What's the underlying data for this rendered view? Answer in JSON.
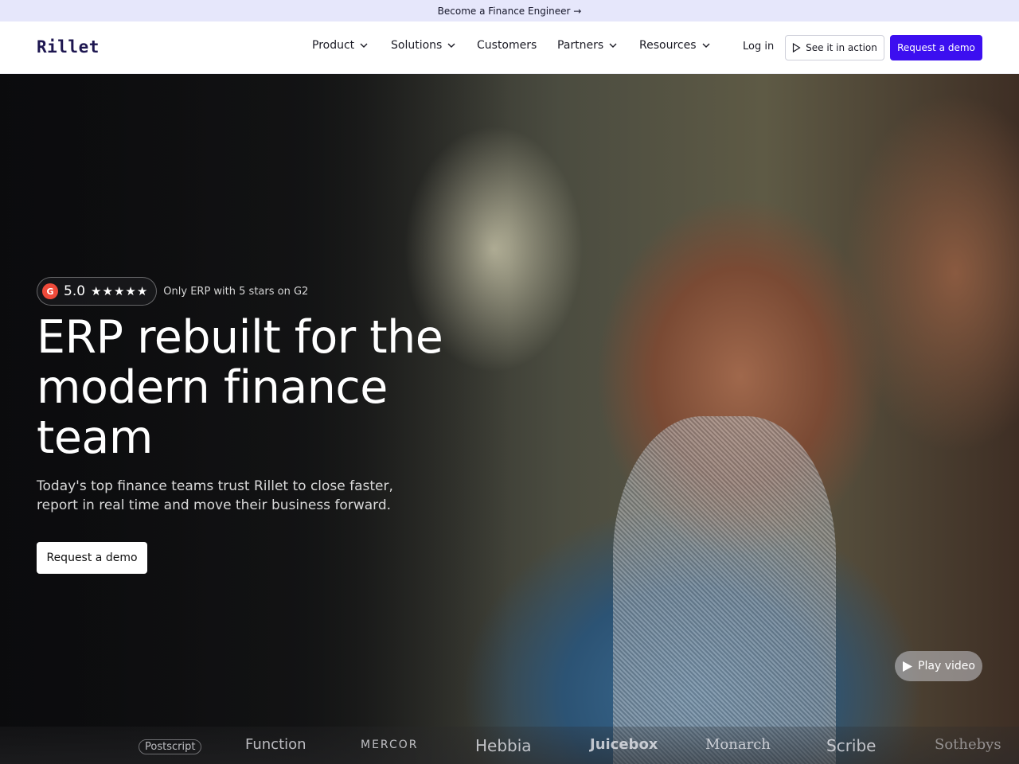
{
  "announcement": {
    "text": "Become a Finance Engineer →"
  },
  "nav": {
    "logo": "Rillet",
    "items": [
      {
        "label": "Product",
        "dropdown": true
      },
      {
        "label": "Solutions",
        "dropdown": true
      },
      {
        "label": "Customers",
        "dropdown": false
      },
      {
        "label": "Partners",
        "dropdown": true
      },
      {
        "label": "Resources",
        "dropdown": true
      }
    ],
    "login": "Log in",
    "see_in_action": "See it in action",
    "request_demo": "Request a demo"
  },
  "hero": {
    "rating": {
      "badge": "G",
      "score": "5.0",
      "stars": 5,
      "stars_glyphs": "★★★★★",
      "text": "Only ERP with 5 stars on G2"
    },
    "headline": "ERP rebuilt for the modern finance team",
    "subtext": "Today's top finance teams trust Rillet to close faster, report in real time and move their business forward.",
    "cta": "Request a demo",
    "play_video": "Play video"
  },
  "customer_logos": [
    "Postscript",
    "Function",
    "MERCOR",
    "Hebbia",
    "Juicebox",
    "Monarch",
    "Scribe",
    "Sothebys"
  ],
  "colors": {
    "accent": "#3c0ff0",
    "announce_bg": "#e6e7fb",
    "logo": "#1d1650"
  }
}
